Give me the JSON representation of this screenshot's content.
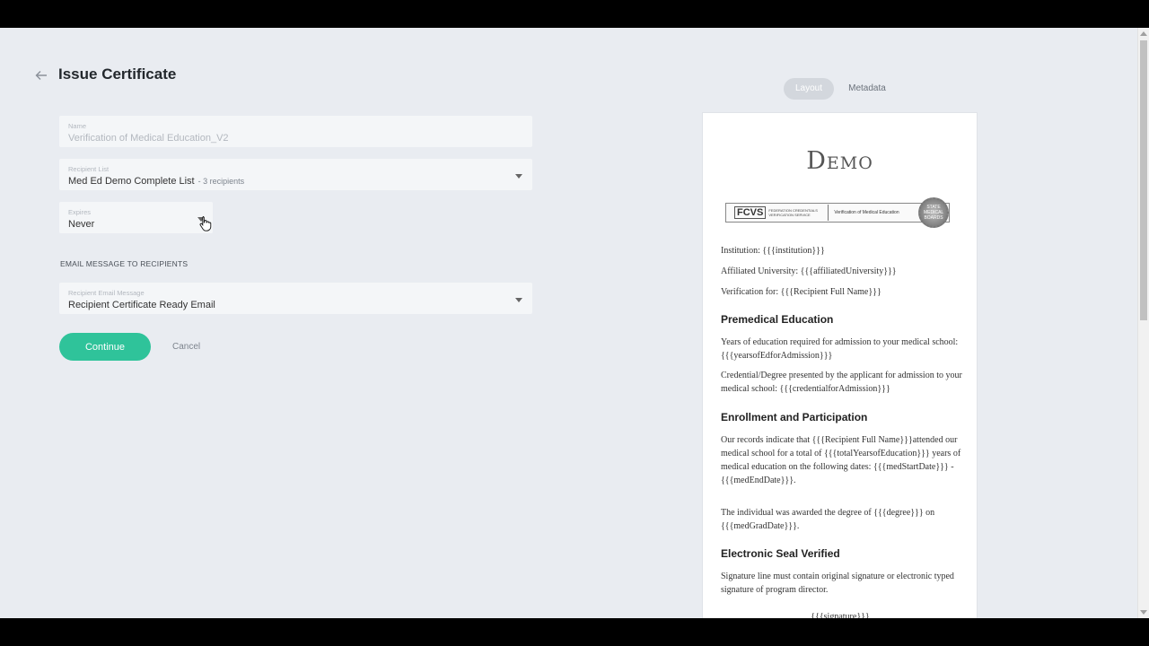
{
  "page": {
    "title": "Issue Certificate"
  },
  "form": {
    "name": {
      "label": "Name",
      "value": "Verification of Medical Education_V2"
    },
    "recipient_list": {
      "label": "Recipient List",
      "value": "Med Ed Demo Complete List",
      "count": "- 3 recipients"
    },
    "expires": {
      "label": "Expires",
      "value": "Never"
    },
    "email_section_label": "EMAIL MESSAGE TO RECIPIENTS",
    "email_message": {
      "label": "Recipient Email Message",
      "value": "Recipient Certificate Ready Email"
    },
    "continue_label": "Continue",
    "cancel_label": "Cancel"
  },
  "tabs": [
    {
      "label": "Layout",
      "active": true
    },
    {
      "label": "Metadata",
      "active": false
    }
  ],
  "preview": {
    "logo": "Demo",
    "banner": {
      "fcvs": "FCVS",
      "fcvs_sub": "FEDERATION CREDENTIALS VERIFICATION SERVICE",
      "vme": "Verification of Medical Education",
      "seal": "STATE MEDICAL BOARDS"
    },
    "lines": {
      "institution": "Institution: {{{institution}}}",
      "affiliated": "Affiliated University: {{{affiliatedUniversity}}}",
      "verification_for": "Verification for: {{{Recipient Full Name}}}"
    },
    "sections": {
      "premedical_heading": "Premedical Education",
      "premedical_p1": "Years of education required for admission to your medical school: {{{yearsofEdforAdmission}}}",
      "premedical_p2": "Credential/Degree presented by the applicant for admission to your medical school: {{{credentialforAdmission}}}",
      "enrollment_heading": "Enrollment and Participation",
      "enrollment_p1": "Our records indicate that {{{Recipient Full Name}}}attended our medical school for a total of {{{totalYearsofEducation}}} years of medical education on the following dates: {{{medStartDate}}} - {{{medEndDate}}}.",
      "enrollment_p2": "The individual was awarded the degree of {{{degree}}} on {{{medGradDate}}}.",
      "seal_heading": "Electronic Seal Verified",
      "seal_p1": "Signature line must contain original signature or electronic typed signature of program director.",
      "signature": "{{{signature}}}"
    }
  },
  "colors": {
    "accent": "#2fc39a",
    "background": "#e9ecf1",
    "field": "#f4f6f8"
  },
  "icons": {
    "back": "arrow-left-icon",
    "dropdown": "chevron-down-icon",
    "cursor": "pointer-cursor-icon"
  }
}
